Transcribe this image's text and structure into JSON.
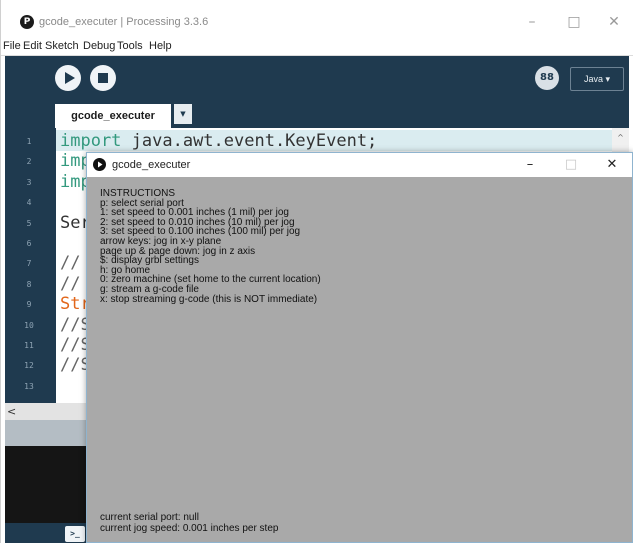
{
  "main_window": {
    "title": "gcode_executer | Processing 3.3.6",
    "app_icon_glyph": "P",
    "minimize_glyph": "–",
    "maximize_glyph": "□",
    "close_glyph": "✕"
  },
  "menu": [
    "File",
    "Edit",
    "Sketch",
    "Debug",
    "Tools",
    "Help"
  ],
  "toolbar": {
    "mode_icon_text": "88",
    "mode_label": "Java ▾"
  },
  "tab": {
    "label": "gcode_executer",
    "arrow": "▼"
  },
  "editor": {
    "line_numbers": [
      "1",
      "2",
      "3",
      "4",
      "5",
      "6",
      "7",
      "8",
      "9",
      "10",
      "11",
      "12",
      "13"
    ],
    "lines": [
      {
        "kw": "import",
        "rest": " java.awt.event.KeyEvent;"
      },
      {
        "kw": "imp",
        "rest": ""
      },
      {
        "kw": "imp",
        "rest": ""
      },
      {
        "kw": "",
        "rest": ""
      },
      {
        "kw": "",
        "rest": "Ser"
      },
      {
        "kw": "",
        "rest": ""
      },
      {
        "cmt": "//"
      },
      {
        "cmt": "//"
      },
      {
        "kw_orange": "Str"
      },
      {
        "cmt": "//S"
      },
      {
        "cmt": "//S"
      },
      {
        "cmt": "//S"
      },
      {
        "kw": "",
        "rest": ""
      }
    ],
    "scroll_up_glyph": "^",
    "scroll_left_glyph": "<"
  },
  "console": {
    "toggle_glyph": ">_"
  },
  "sketch_window": {
    "title": "gcode_executer",
    "minimize_glyph": "–",
    "maximize_glyph": "□",
    "close_glyph": "✕",
    "instructions": [
      "INSTRUCTIONS",
      "p: select serial port",
      "1: set speed to 0.001 inches (1 mil) per jog",
      "2: set speed to 0.010 inches (10 mil) per jog",
      "3: set speed to 0.100 inches (100 mil) per jog",
      "arrow keys: jog in x-y plane",
      "page up & page down: jog in z axis",
      "$: display grbl settings",
      "h: go home",
      "0: zero machine (set home to the current location)",
      "g: stream a g-code file",
      "x: stop streaming g-code (this is NOT immediate)"
    ],
    "status": [
      "current serial port: null",
      "current jog speed: 0.001 inches per step"
    ]
  },
  "colors": {
    "chrome_dark": "#1f3a4f",
    "keyword": "#33997e",
    "string_type": "#e2661a",
    "sketch_background": "#a9a9a9"
  }
}
